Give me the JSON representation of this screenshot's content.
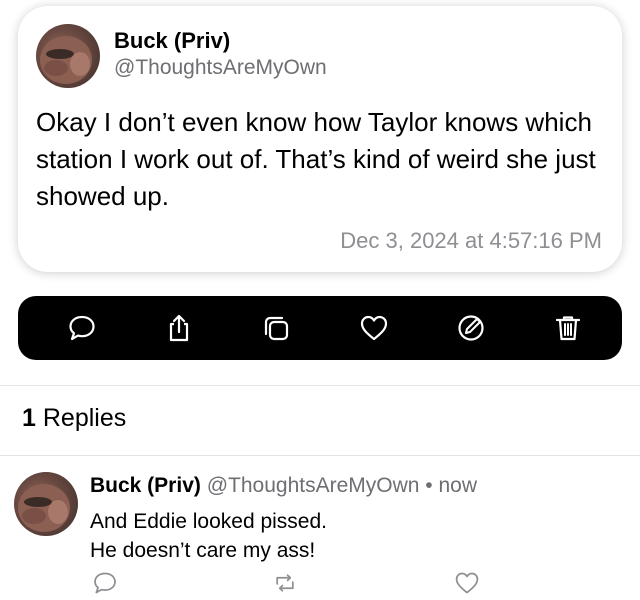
{
  "post": {
    "author_name": "Buck (Priv)",
    "author_handle": "@ThoughtsAreMyOwn",
    "text": "Okay I don’t even know how Taylor knows which station I work out of. That’s kind of weird she just showed up.",
    "timestamp": "Dec 3, 2024 at 4:57:16 PM"
  },
  "actions": [
    "comment-icon",
    "share-icon",
    "copy-icon",
    "heart-icon",
    "edit-icon",
    "trash-icon"
  ],
  "replies": {
    "count": "1",
    "label": "Replies"
  },
  "reply": {
    "author_name": "Buck (Priv)",
    "author_handle": "@ThoughtsAreMyOwn",
    "separator": "•",
    "time": "now",
    "line1": "And Eddie looked pissed.",
    "line2": "He doesn’t care my ass!",
    "actions": [
      "comment-icon",
      "repost-icon",
      "heart-icon"
    ]
  },
  "colors": {
    "action_bar": "#000000",
    "secondary_text": "#6e6e73",
    "timestamp": "#8e8e93",
    "reply_icons": "#8e8e93"
  }
}
